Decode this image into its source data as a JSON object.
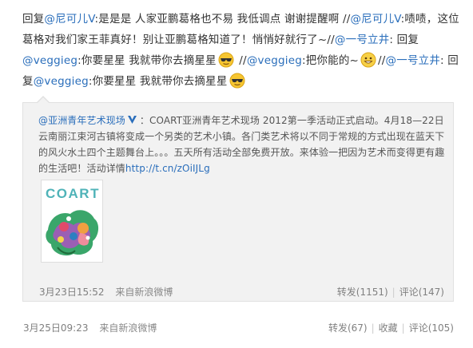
{
  "post": {
    "segments": [
      {
        "t": "text",
        "v": "回复"
      },
      {
        "t": "mention",
        "v": "@尼可儿V"
      },
      {
        "t": "text",
        "v": ":是是是 人家亚鹏葛格也不易 我低调点 谢谢提醒啊 //"
      },
      {
        "t": "mention",
        "v": "@尼可儿V"
      },
      {
        "t": "text",
        "v": ":啧啧，这位葛格对我们家王菲真好！别让亚鹏葛格知道了！悄悄好就行了~//"
      },
      {
        "t": "mention",
        "v": "@一号立井"
      },
      {
        "t": "text",
        "v": ": 回复"
      },
      {
        "t": "mention",
        "v": "@veggieg"
      },
      {
        "t": "text",
        "v": ":你要星星 我就带你去摘星星"
      },
      {
        "t": "emoji",
        "v": "cool-face-emoji"
      },
      {
        "t": "text",
        "v": " //"
      },
      {
        "t": "mention",
        "v": "@veggieg"
      },
      {
        "t": "text",
        "v": ":把你能的~"
      },
      {
        "t": "emoji",
        "v": "grin-face-emoji"
      },
      {
        "t": "text",
        "v": "//"
      },
      {
        "t": "mention",
        "v": "@一号立井"
      },
      {
        "t": "text",
        "v": ": 回复"
      },
      {
        "t": "mention",
        "v": "@veggieg"
      },
      {
        "t": "text",
        "v": ":你要星星 我就带你去摘星星"
      },
      {
        "t": "emoji",
        "v": "cool-face-emoji"
      }
    ],
    "time": "3月25日09:23",
    "source": "来自新浪微博",
    "actions": {
      "repost": "转发(67)",
      "favorite": "收藏",
      "comment": "评论(105)"
    }
  },
  "repost": {
    "author": "@亚洲青年艺术现场",
    "body": "：COART亚洲青年艺术现场 2012第一季活动正式启动。4月18—22日云南丽江束河古镇将变成一个另类的艺术小镇。各门类艺术将以不同于常规的方式出现在蓝天下的风火水土四个主题舞台上。。。五天所有活动全部免费开放。来体验一把因为艺术而变得更有趣的生活吧！活动详情",
    "link": "http://t.cn/zOiIJLg",
    "image_brand": "COART",
    "time": "3月23日15:52",
    "source": "来自新浪微博",
    "actions": {
      "repost": "转发(1151)",
      "comment": "评论(147)"
    }
  },
  "colors": {
    "link": "#2a6ebb",
    "meta": "#808080",
    "repost_bg": "#f2f2f2",
    "brand": "#4fb3b8"
  }
}
